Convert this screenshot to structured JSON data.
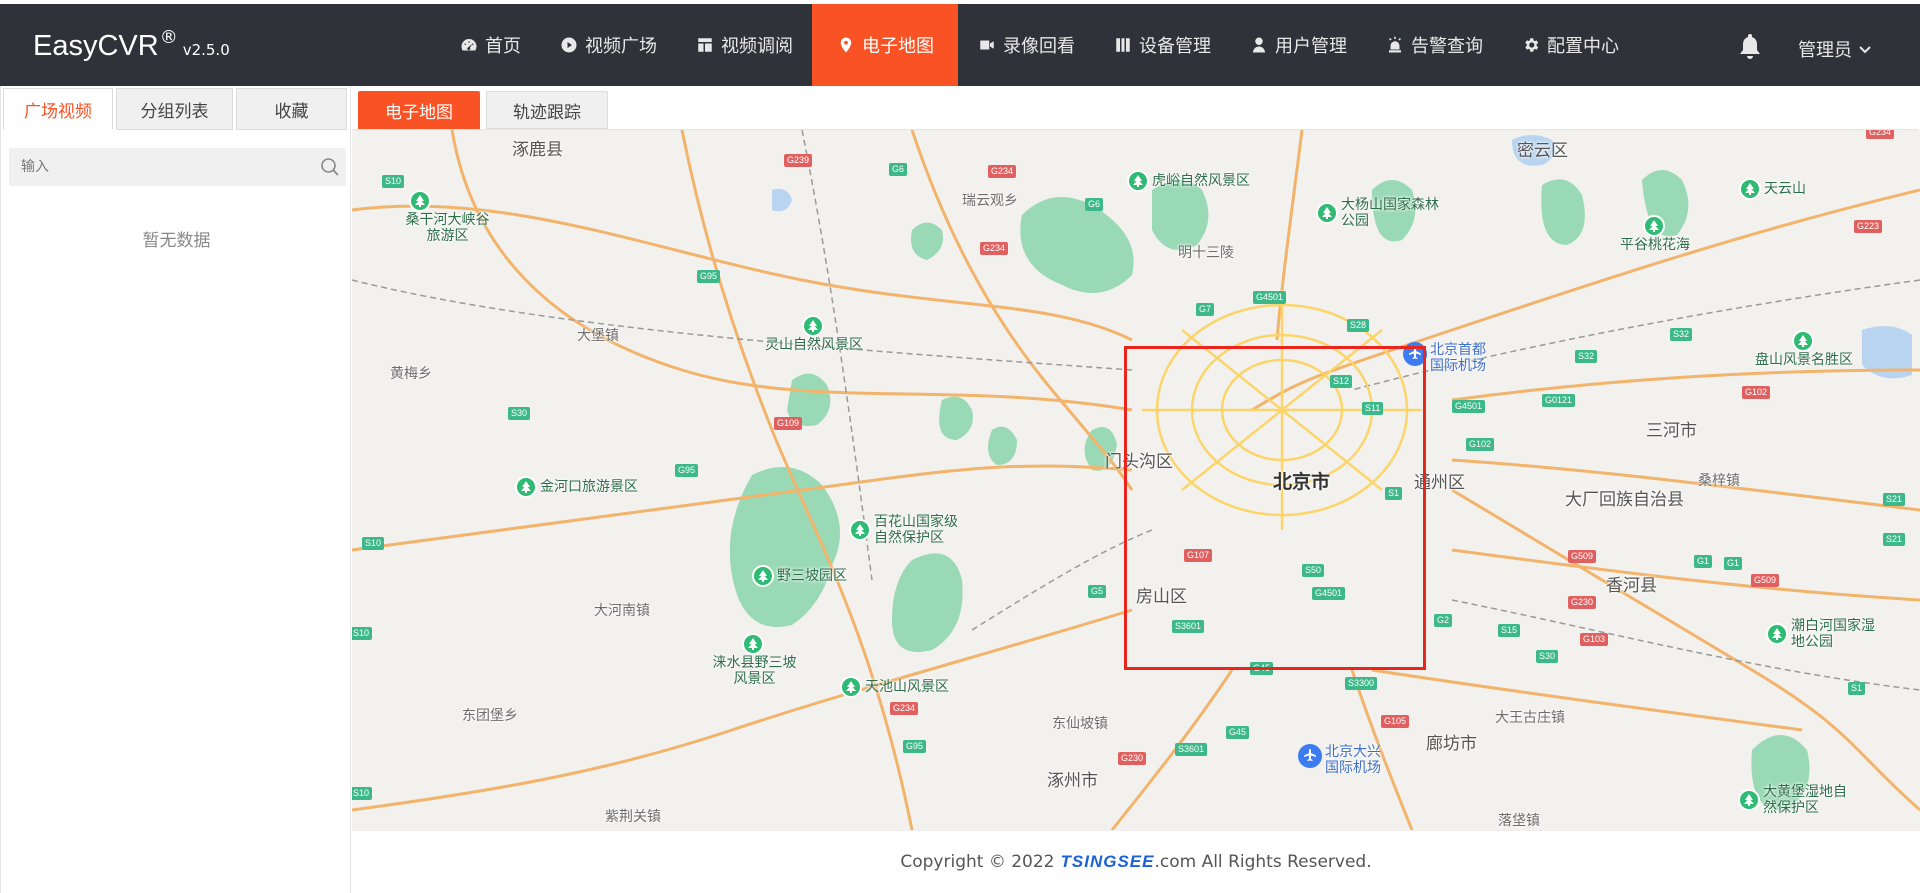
{
  "app": {
    "brand": "EasyCVR",
    "brand_mark": "®",
    "version": "v2.5.0"
  },
  "nav": {
    "items": [
      {
        "label": "首页",
        "icon": "dashboard-icon"
      },
      {
        "label": "视频广场",
        "icon": "play-circle-icon"
      },
      {
        "label": "视频调阅",
        "icon": "layout-icon"
      },
      {
        "label": "电子地图",
        "icon": "map-pin-icon",
        "active": true
      },
      {
        "label": "录像回看",
        "icon": "video-camera-icon"
      },
      {
        "label": "设备管理",
        "icon": "device-icon"
      },
      {
        "label": "用户管理",
        "icon": "user-icon"
      },
      {
        "label": "告警查询",
        "icon": "alarm-icon"
      },
      {
        "label": "配置中心",
        "icon": "gear-icon"
      }
    ],
    "user": "管理员"
  },
  "sidebar": {
    "tabs": [
      "广场视频",
      "分组列表",
      "收藏"
    ],
    "active_tab": "广场视频",
    "search_placeholder": "输入",
    "empty_text": "暂无数据"
  },
  "main": {
    "tabs": [
      "电子地图",
      "轨迹跟踪"
    ],
    "active_tab": "电子地图"
  },
  "map": {
    "city_label": "北京市",
    "places": {
      "p1": "涿鹿县",
      "p2": "瑞云观乡",
      "p3": "密云区",
      "p4": "大堡镇",
      "p5": "黄梅乡",
      "p6": "门头沟区",
      "p7": "通州区",
      "p8": "三河市",
      "p9": "大厂回族自治县",
      "p10": "桑梓镇",
      "p11": "房山区",
      "p12": "香河县",
      "p13": "大河南镇",
      "p14": "东团堡乡",
      "p15": "东仙坡镇",
      "p16": "涿州市",
      "p17": "廊坊市",
      "p18": "大王古庄镇",
      "p19": "紫荆关镇",
      "p20": "落垡镇",
      "p21": "明十三陵"
    },
    "scenic": {
      "s1": "虎峪自然风景区",
      "s2": "大杨山国家森林公园",
      "s3": "天云山",
      "s4": "平谷桃花海",
      "s5": "桑干河大峡谷旅游区",
      "s6": "灵山自然风景区",
      "s7": "盘山风景名胜区",
      "s8": "金河口旅游景区",
      "s9": "百花山国家级自然保护区",
      "s10": "野三坡园区",
      "s11": "涞水县野三坡风景区",
      "s12": "天池山风景区",
      "s13": "潮白河国家湿地公园",
      "s14": "大黄堡湿地自然保护区"
    },
    "airports": {
      "a1": "北京首都国际机场",
      "a2": "北京大兴国际机场"
    },
    "highways": {
      "h1": "G239",
      "h2": "G6",
      "h3": "G234",
      "h4": "G6",
      "h5": "S10",
      "h6": "G95",
      "h7": "G234",
      "h8": "G4501",
      "h9": "G7",
      "h10": "S28",
      "h11": "S32",
      "h12": "S32",
      "h13": "S12",
      "h14": "S11",
      "h15": "G4501",
      "h16": "G0121",
      "h17": "G102",
      "h18": "G102",
      "h19": "S30",
      "h20": "G109",
      "h21": "G95",
      "h22": "S1",
      "h23": "S10",
      "h24": "G107",
      "h25": "S50",
      "h26": "G509",
      "h27": "G1",
      "h28": "G1",
      "h29": "G509",
      "h30": "G5",
      "h31": "G4501",
      "h32": "G230",
      "h33": "S3601",
      "h34": "G2",
      "h35": "S15",
      "h36": "G103",
      "h37": "S30",
      "h38": "G45",
      "h39": "S3300",
      "h40": "G234",
      "h41": "G95",
      "h42": "G105",
      "h43": "G45",
      "h44": "S3601",
      "h45": "G230",
      "h46": "S10",
      "h47": "S10",
      "h48": "G223",
      "h49": "S21",
      "h50": "S21",
      "h51": "S1",
      "h52": "G234"
    }
  },
  "footer": {
    "before": "Copyright © 2022",
    "logo": "TSINGSEE",
    "after": ".com All Rights Reserved."
  },
  "colors": {
    "nav_bg": "#2f3238",
    "accent": "#f95225",
    "selection": "#e8261d",
    "scenic_green": "#2fbb73",
    "airport_blue": "#3d7cf0"
  }
}
